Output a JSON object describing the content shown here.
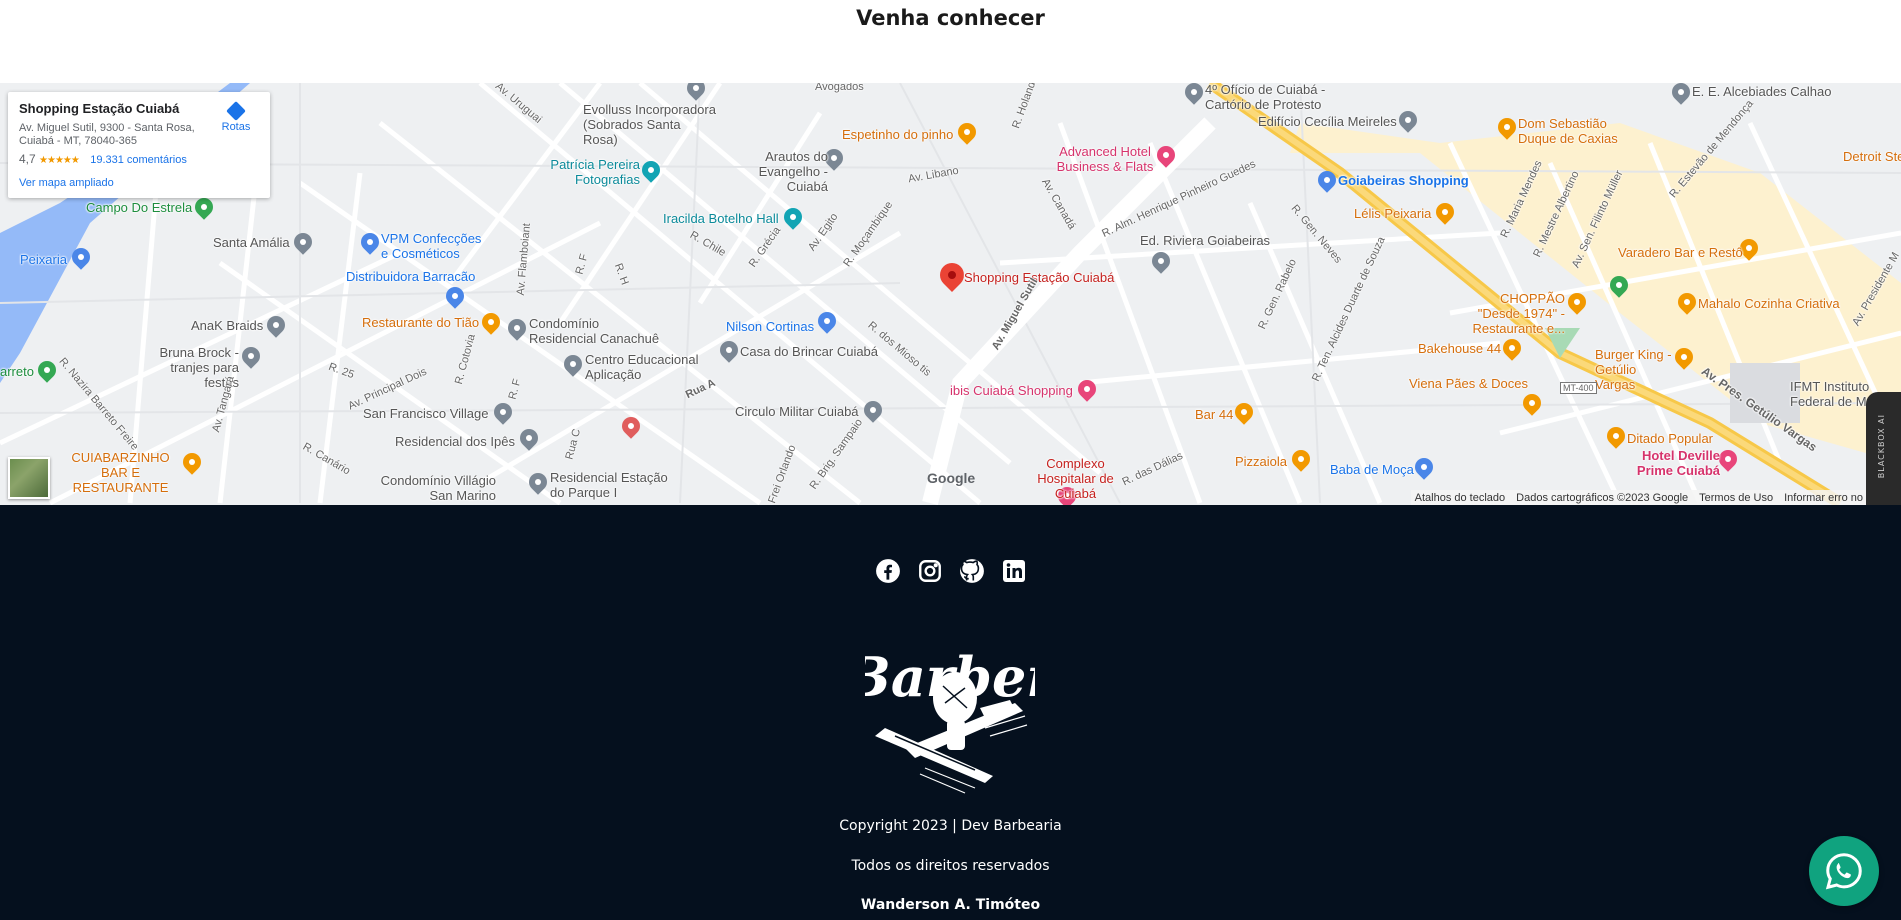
{
  "section": {
    "title": "Venha conhecer"
  },
  "map": {
    "place_name": "Shopping Estação Cuiabá",
    "address": "Av. Miguel Sutil, 9300 - Santa Rosa, Cuiabá - MT, 78040-365",
    "rating": "4,7",
    "reviews": "19.331 comentários",
    "directions_label": "Rotas",
    "larger_map_label": "Ver mapa ampliado",
    "attribution": {
      "shortcuts": "Atalhos do teclado",
      "data": "Dados cartográficos ©2023 Google",
      "terms": "Termos de Uso",
      "report": "Informar erro no"
    },
    "google_logo": "Google",
    "places": [
      {
        "text": "Shopping Estação Cuiabá",
        "style": "red"
      },
      {
        "text": "Evolluss Incorporadora (Sobrados Santa Rosa)",
        "style": "gray"
      },
      {
        "text": "Arautos do Evangelho - Cuiabá",
        "style": "gray"
      },
      {
        "text": "Espetinho do pinho",
        "style": "orange"
      },
      {
        "text": "Advanced Hotel Business & Flats",
        "style": "pink"
      },
      {
        "text": "4º Ofício de Cuiabá - Cartório de Protesto",
        "style": "gray"
      },
      {
        "text": "Edifício Cecília Meireles",
        "style": "gray"
      },
      {
        "text": "Dom Sebastião Duque de Caxias",
        "style": "orange"
      },
      {
        "text": "E. E. Alcebiades Calhao",
        "style": "gray"
      },
      {
        "text": "Patrícia Pereira Fotografias",
        "style": "teal"
      },
      {
        "text": "Goiabeiras Shopping",
        "style": "blue"
      },
      {
        "text": "Lélis Peixaria",
        "style": "orange"
      },
      {
        "text": "Detroit Stea",
        "style": "orange"
      },
      {
        "text": "Campo Do Estrela",
        "style": "green"
      },
      {
        "text": "Iracilda Botelho Hall",
        "style": "teal"
      },
      {
        "text": "Santa Amália",
        "style": "gray"
      },
      {
        "text": "VPM Confecções e Cosméticos",
        "style": "blue"
      },
      {
        "text": "Peixaria",
        "style": "blue"
      },
      {
        "text": "Ed. Riviera Goiabeiras",
        "style": "gray"
      },
      {
        "text": "Varadero Bar e Restô",
        "style": "orange"
      },
      {
        "text": "Distribuidora Barracão",
        "style": "blue"
      },
      {
        "text": "CHOPPÃO \"Desde 1974\" - Restaurante e...",
        "style": "orange"
      },
      {
        "text": "Mahalo Cozinha Criativa",
        "style": "orange"
      },
      {
        "text": "AnaK Braids",
        "style": "gray"
      },
      {
        "text": "Restaurante do Tião",
        "style": "orange"
      },
      {
        "text": "Condomínio Residencial Canachuê",
        "style": "gray"
      },
      {
        "text": "Nilson Cortinas",
        "style": "blue"
      },
      {
        "text": "Bruna Brock - tranjes para festas",
        "style": "gray"
      },
      {
        "text": "Casa do Brincar Cuiabá",
        "style": "gray"
      },
      {
        "text": "Centro Educacional Aplicação",
        "style": "gray"
      },
      {
        "text": "Bakehouse 44",
        "style": "orange"
      },
      {
        "text": "Burger King - Getúlio Vargas",
        "style": "orange"
      },
      {
        "text": "ibis Cuiabá Shopping",
        "style": "pink"
      },
      {
        "text": "Viena Pães & Doces",
        "style": "orange"
      },
      {
        "text": "IFMT Instituto Federal de Mato",
        "style": "gray"
      },
      {
        "text": "San Francisco Village",
        "style": "gray"
      },
      {
        "text": "Circulo Militar Cuiabá",
        "style": "gray"
      },
      {
        "text": "Bar 44",
        "style": "orange"
      },
      {
        "text": "Residencial dos Ipês",
        "style": "gray"
      },
      {
        "text": "Ditado Popular",
        "style": "orange"
      },
      {
        "text": "CUIABARZINHO BAR E RESTAURANTE",
        "style": "orange"
      },
      {
        "text": "Complexo Hospitalar de Cuiabá",
        "style": "red"
      },
      {
        "text": "Pizzaiola",
        "style": "orange"
      },
      {
        "text": "Baba de Moça",
        "style": "blue"
      },
      {
        "text": "Hotel Deville Prime Cuiabá",
        "style": "pink"
      },
      {
        "text": "Condomínio Villágio San Marino",
        "style": "gray"
      },
      {
        "text": "Residencial Estação do Parque I",
        "style": "gray"
      },
      {
        "text": "arreto",
        "style": "green"
      }
    ],
    "streets": [
      "Av. Uruguai",
      "Avogados",
      "R. Holanda",
      "Av. Libano",
      "Av. Canadá",
      "R. Alm. Henrique Pinheiro Guedes",
      "R. Chile",
      "R. Grécia",
      "Av. Egito",
      "R. Moçambique",
      "R. dos Mioso tis",
      "Av. Miguel Sutil",
      "R. Gen. Neves",
      "R. Gen. Rabelo",
      "R. Ten. Alcides Duarte de Souza",
      "R. Maria Mendes",
      "R. Mestre Albertino",
      "Av. Sen. Filinto Müller",
      "R. Estevão de Mendonça",
      "Av. Presidente M",
      "Av. Pres. Getúlio Vargas",
      "MT-400",
      "R. Nazira Barreto Freire",
      "Av. Tangará",
      "R. 25",
      "Av. Principal Dois",
      "R. Cotovia",
      "R. F",
      "R. H",
      "Av. Flamboiant",
      "Rua A",
      "Rua C",
      "R. Canário",
      "Frei Orlando",
      "R. Brig. Sampaio",
      "R. das Dálias"
    ]
  },
  "footer": {
    "socials": [
      "Facebook",
      "Instagram",
      "GitHub",
      "LinkedIn"
    ],
    "logo_text": "Barber",
    "copyright": "Copyright 2023 | Dev Barbearia",
    "rights": "Todos os direitos reservados",
    "author": "Wanderson A. Timóteo"
  },
  "extension": {
    "label": "BLACKBOX AI"
  },
  "colors": {
    "footer_bg": "#05101e",
    "whatsapp": "#10a37f",
    "map_bg": "#e8eaed"
  }
}
